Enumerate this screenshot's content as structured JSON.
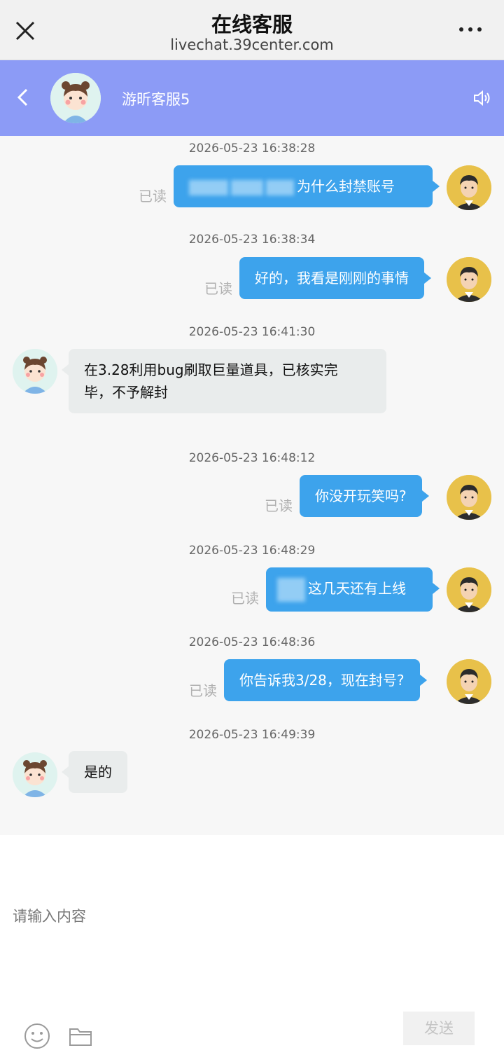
{
  "topbar": {
    "title": "在线客服",
    "url": "livechat.39center.com"
  },
  "chat_header": {
    "agent_name": "游昕客服5"
  },
  "messages": [
    {
      "time": "2026-05-23 16:38:28",
      "from": "user",
      "text": "为什么封禁账号",
      "status": "已读"
    },
    {
      "time": "2026-05-23 16:38:34",
      "from": "user",
      "text": "好的，我看是刚刚的事情",
      "status": "已读"
    },
    {
      "time": "2026-05-23 16:41:30",
      "from": "agent",
      "line1": "在3.28利用bug刷取巨量道具，已核实完",
      "line2": "毕，不予解封"
    },
    {
      "time": "2026-05-23 16:48:12",
      "from": "user",
      "text": "你没开玩笑吗?",
      "status": "已读"
    },
    {
      "time": "2026-05-23 16:48:29",
      "from": "user",
      "text": "这几天还有上线",
      "status": "已读"
    },
    {
      "time": "2026-05-23 16:48:36",
      "from": "user",
      "text": "你告诉我3/28，现在封号?",
      "status": "已读"
    },
    {
      "time": "2026-05-23 16:49:39",
      "from": "agent",
      "text": "是的"
    }
  ],
  "composer": {
    "placeholder": "请输入内容",
    "send_label": "发送"
  },
  "colors": {
    "header": "#8c9bf6",
    "user_bubble": "#3da3ec",
    "agent_bubble": "#e9ecec"
  }
}
